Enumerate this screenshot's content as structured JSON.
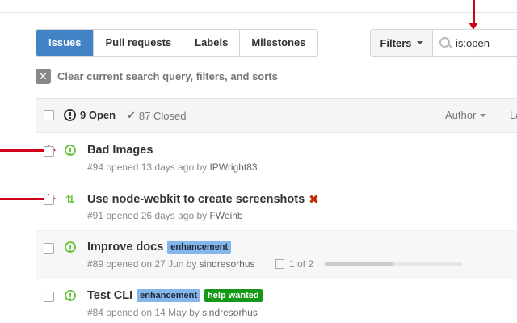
{
  "tabs": [
    {
      "label": "Issues",
      "active": true
    },
    {
      "label": "Pull requests",
      "active": false
    },
    {
      "label": "Labels",
      "active": false
    },
    {
      "label": "Milestones",
      "active": false
    }
  ],
  "filters": {
    "label": "Filters"
  },
  "search": {
    "value": "is:open"
  },
  "clear": {
    "label": "Clear current search query, filters, and sorts"
  },
  "header": {
    "open_label": "9 Open",
    "closed_label": "87 Closed",
    "author_label": "Author",
    "label_cut": "La"
  },
  "issues": [
    {
      "title": "Bad Images",
      "meta": "#94 opened 13 days ago by ",
      "user": "IPWright83",
      "type": "issue"
    },
    {
      "title": "Use node-webkit to create screenshots",
      "meta": "#91 opened 26 days ago by ",
      "user": "FWeinb",
      "type": "pull-request",
      "status_mark": "✖"
    },
    {
      "title": "Improve docs",
      "meta": "#89 opened on 27 Jun by ",
      "user": "sindresorhus",
      "type": "issue",
      "labels": [
        "enhancement"
      ],
      "progress_text": "1 of 2",
      "progress": 0.5
    },
    {
      "title": "Test CLI",
      "meta": "#84 opened on 14 May by ",
      "user": "sindresorhus",
      "type": "issue",
      "labels": [
        "enhancement",
        "help wanted"
      ]
    }
  ],
  "colors": {
    "accent": "#4183c4",
    "open": "#6cc644",
    "annotation": "#d0021b",
    "enhancement": "#84b6eb",
    "help_wanted": "#159818"
  }
}
